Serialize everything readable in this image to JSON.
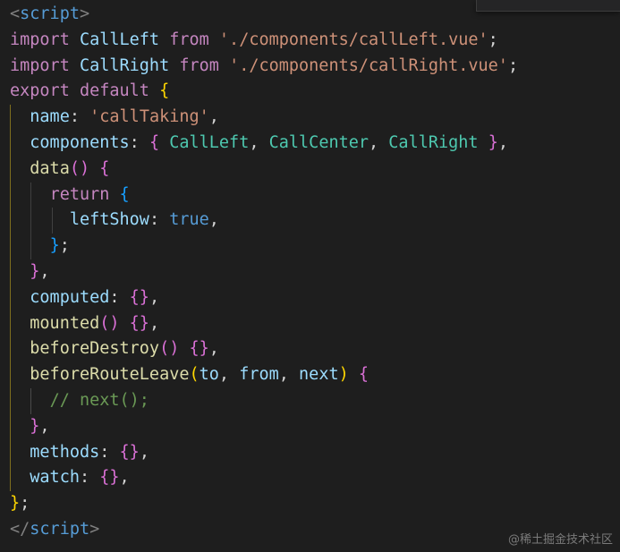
{
  "editor": {
    "watermark": "@稀土掘金技术社区"
  },
  "code": {
    "l1_open": "<",
    "l1_tag": "script",
    "l1_close": ">",
    "l2_kw": "import",
    "l2_name": "CallLeft",
    "l2_from": "from",
    "l2_path": "'./components/callLeft.vue'",
    "l2_semi": ";",
    "l3_kw": "import",
    "l3_name": "CallRight",
    "l3_from": "from",
    "l3_path": "'./components/callRight.vue'",
    "l3_semi": ";",
    "l4_kw1": "export",
    "l4_kw2": "default",
    "l4_brace": "{",
    "l5_key": "name",
    "l5_colon": ": ",
    "l5_val": "'callTaking'",
    "l5_comma": ",",
    "l6_key": "components",
    "l6_colon": ": ",
    "l6_open": "{",
    "l6_c1": "CallLeft",
    "l6_sep1": ", ",
    "l6_c2": "CallCenter",
    "l6_sep2": ", ",
    "l6_c3": "CallRight",
    "l6_close": "}",
    "l6_comma": ",",
    "l7_fn": "data",
    "l7_parens": "()",
    "l7_brace": "{",
    "l8_kw": "return",
    "l8_brace": "{",
    "l9_key": "leftShow",
    "l9_colon": ": ",
    "l9_val": "true",
    "l9_comma": ",",
    "l10_brace": "}",
    "l10_semi": ";",
    "l11_brace": "}",
    "l11_comma": ",",
    "l12_key": "computed",
    "l12_colon": ": ",
    "l12_braces": "{}",
    "l12_comma": ",",
    "l13_fn": "mounted",
    "l13_parens": "()",
    "l13_braces": "{}",
    "l13_comma": ",",
    "l14_fn": "beforeDestroy",
    "l14_parens": "()",
    "l14_braces": "{}",
    "l14_comma": ",",
    "l15_fn": "beforeRouteLeave",
    "l15_popen": "(",
    "l15_a1": "to",
    "l15_sep1": ", ",
    "l15_a2": "from",
    "l15_sep2": ", ",
    "l15_a3": "next",
    "l15_pclose": ")",
    "l15_brace": "{",
    "l16_comment": "// next();",
    "l17_brace": "}",
    "l17_comma": ",",
    "l18_key": "methods",
    "l18_colon": ": ",
    "l18_braces": "{}",
    "l18_comma": ",",
    "l19_key": "watch",
    "l19_colon": ": ",
    "l19_braces": "{}",
    "l19_comma": ",",
    "l20_brace": "}",
    "l20_semi": ";",
    "l21_open": "</",
    "l21_tag": "script",
    "l21_close": ">"
  }
}
